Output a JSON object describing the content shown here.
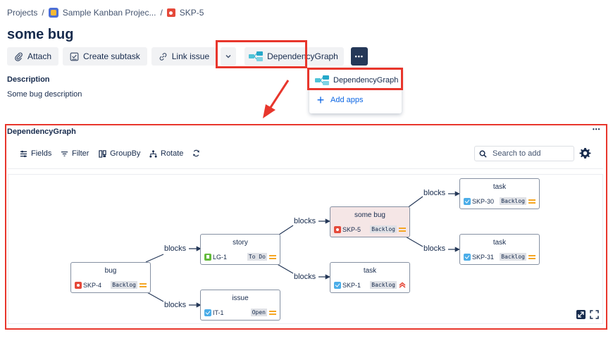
{
  "breadcrumb": {
    "projects": "Projects",
    "sep1": "/",
    "project": "Sample Kanban Projec...",
    "sep2": "/",
    "issue_key": "SKP-5"
  },
  "issue": {
    "title": "some bug"
  },
  "toolbar": {
    "attach": "Attach",
    "create_subtask": "Create subtask",
    "link_issue": "Link issue",
    "dependency_graph": "DependencyGraph",
    "more": "•••"
  },
  "dropdown": {
    "items": [
      {
        "label": "DependencyGraph"
      },
      {
        "label": "Add apps"
      }
    ]
  },
  "description": {
    "title": "Description",
    "text": "Some bug description"
  },
  "panel": {
    "title": "DependencyGraph",
    "more": "•••",
    "tools": {
      "fields": "Fields",
      "filter": "Filter",
      "groupby": "GroupBy",
      "rotate": "Rotate"
    },
    "search_placeholder": "Search to add"
  },
  "graph": {
    "edge_label": "blocks",
    "nodes": [
      {
        "id": "bug",
        "title": "bug",
        "key": "SKP-4",
        "type": "bug",
        "status": "Backlog",
        "priority": "medium"
      },
      {
        "id": "story",
        "title": "story",
        "key": "LG-1",
        "type": "story",
        "status": "To Do",
        "priority": "medium"
      },
      {
        "id": "issue",
        "title": "issue",
        "key": "IT-1",
        "type": "task",
        "status": "Open",
        "priority": "medium"
      },
      {
        "id": "somebug",
        "title": "some bug",
        "key": "SKP-5",
        "type": "bug",
        "status": "Backlog",
        "priority": "medium"
      },
      {
        "id": "task1",
        "title": "task",
        "key": "SKP-1",
        "type": "task",
        "status": "Backlog",
        "priority": "high"
      },
      {
        "id": "task30",
        "title": "task",
        "key": "SKP-30",
        "type": "task",
        "status": "Backlog",
        "priority": "medium"
      },
      {
        "id": "task31",
        "title": "task",
        "key": "SKP-31",
        "type": "task",
        "status": "Backlog",
        "priority": "medium"
      }
    ]
  },
  "colors": {
    "highlight_border": "#e8362c",
    "bug": "#e5493a",
    "story": "#63ba3c",
    "task": "#4bade8",
    "priority_medium": "#f5a623",
    "more_button": "#253858",
    "link_blue": "#0c66e4"
  }
}
